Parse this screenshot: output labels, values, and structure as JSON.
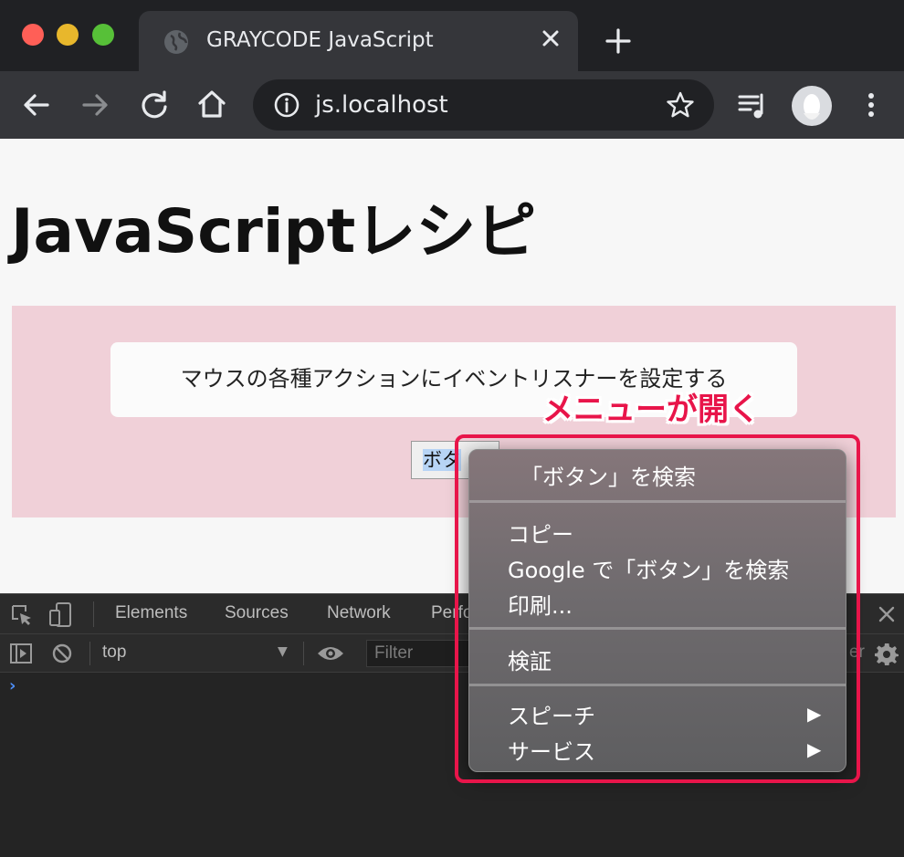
{
  "browser": {
    "tab_title": "GRAYCODE JavaScript",
    "url": "js.localhost"
  },
  "page": {
    "title": "JavaScriptレシピ",
    "description": "マウスの各種アクションにイベントリスナーを設定する",
    "button_label": "ボタン",
    "button_visible_text": "ボタ"
  },
  "devtools": {
    "tabs": [
      "Elements",
      "Sources",
      "Network",
      "Perfo"
    ],
    "context": "top",
    "filter_placeholder": "Filter",
    "right_truncated": "er"
  },
  "context_menu": {
    "search_selection": "「ボタン」を検索",
    "copy": "コピー",
    "google_search": "Google で「ボタン」を検索",
    "print": "印刷...",
    "inspect": "検証",
    "speech": "スピーチ",
    "services": "サービス",
    "submenu_arrow": "▶"
  },
  "annotation": {
    "label": "メニューが開く",
    "color": "#e8154a"
  },
  "colors": {
    "tabstrip": "#202124",
    "toolbar": "#35363a",
    "panel": "#f0d0d8",
    "devtools_bg": "#242424"
  }
}
